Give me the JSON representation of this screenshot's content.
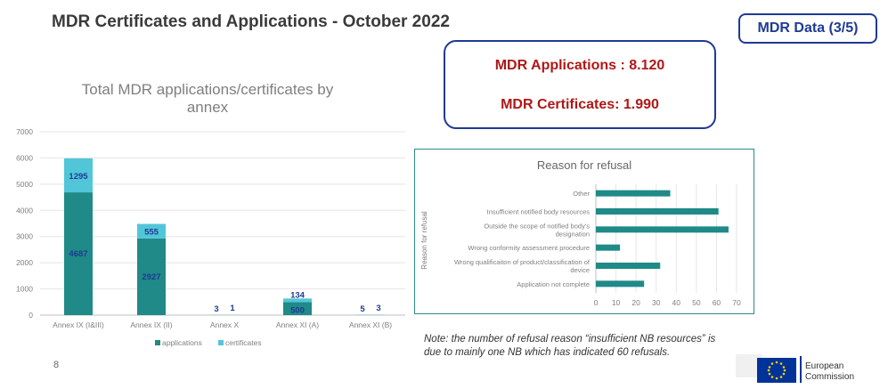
{
  "header": {
    "title": "MDR Certificates and Applications - October 2022",
    "badge": "MDR Data (3/5)"
  },
  "summary": {
    "applications": "MDR Applications : 8.120",
    "certificates": "MDR Certificates: 1.990"
  },
  "note": "Note: the number of refusal reason “insufficient NB resources” is due to mainly one NB which has indicated 60 refusals.",
  "page_number": "8",
  "logo": {
    "line1": "European",
    "line2": "Commission"
  },
  "colors": {
    "applications": "#1f8a87",
    "certificates": "#52c6d9",
    "refusal_bars": "#1f8a87",
    "accent_blue": "#1f3a93",
    "accent_red": "#b01717"
  },
  "chart_data": [
    {
      "type": "bar",
      "stacked": true,
      "title_lines": [
        "Total MDR applications/certificates by",
        "annex"
      ],
      "categories": [
        "Annex IX (I&III)",
        "Annex IX (II)",
        "Annex X",
        "Annex XI (A)",
        "Annex XI (B)"
      ],
      "series": [
        {
          "name": "applications",
          "values": [
            4687,
            2927,
            3,
            500,
            5
          ]
        },
        {
          "name": "certificates",
          "values": [
            1295,
            555,
            1,
            134,
            3
          ]
        }
      ],
      "ylim": [
        0,
        7000
      ],
      "yticks": [
        "0",
        "1000",
        "2000",
        "3000",
        "4000",
        "5000",
        "6000",
        "7000"
      ],
      "grid": true,
      "legend": "bottom"
    },
    {
      "type": "bar",
      "orientation": "horizontal",
      "title": "Reason for refusal",
      "ylabel": "Reason for refusal",
      "categories": [
        [
          "Other"
        ],
        [
          "Insufficient notified body resources"
        ],
        [
          "Outside the scope of notified body's",
          "designation"
        ],
        [
          "Wrong conformity assessment procedure"
        ],
        [
          "Wrong qualificaiton of product/classification of",
          "device"
        ],
        [
          "Application not complete"
        ]
      ],
      "values": [
        37,
        61,
        66,
        12,
        32,
        24
      ],
      "xlim": [
        0,
        70
      ],
      "xticks": [
        "0",
        "10",
        "20",
        "30",
        "40",
        "50",
        "60",
        "70"
      ],
      "grid": true
    }
  ]
}
